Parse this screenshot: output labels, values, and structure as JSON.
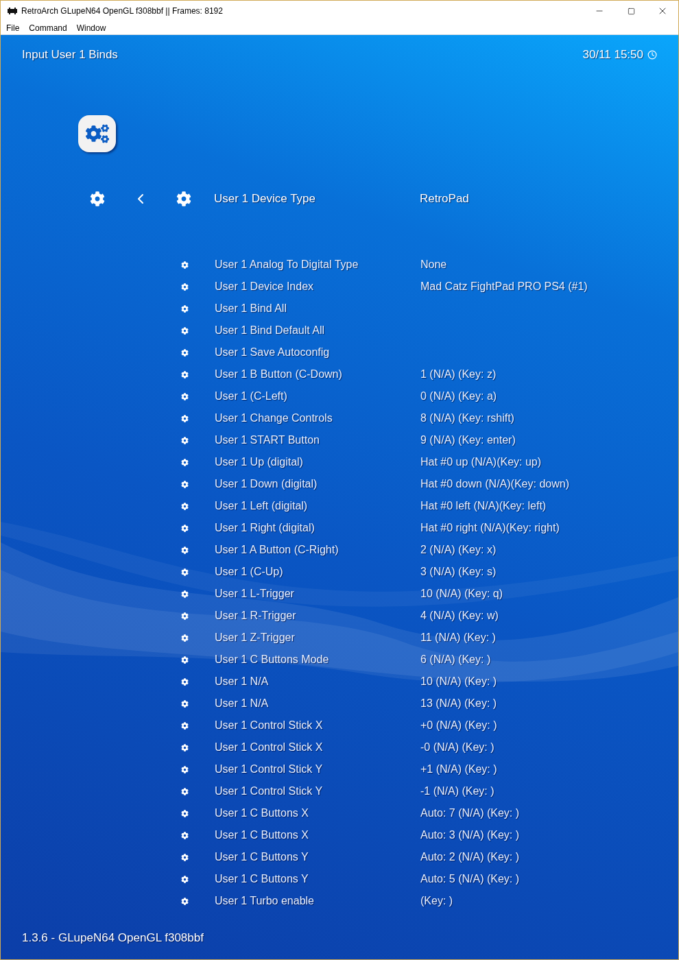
{
  "window": {
    "title": "RetroArch GLupeN64 OpenGL f308bbf || Frames: 8192"
  },
  "menu": [
    "File",
    "Command",
    "Window"
  ],
  "header": {
    "title": "Input User 1 Binds",
    "clock": "30/11 15:50"
  },
  "items": [
    {
      "label": "User 1 Device Type",
      "value": "RetroPad",
      "selected": true
    },
    {
      "label": "User 1 Analog To Digital Type",
      "value": "None",
      "selected": false
    },
    {
      "label": "User 1 Device Index",
      "value": "Mad Catz FightPad PRO PS4 (#1)",
      "selected": false
    },
    {
      "label": "User 1 Bind All",
      "selected": false
    },
    {
      "label": "User 1 Bind Default All",
      "selected": false
    },
    {
      "label": "User 1 Save Autoconfig",
      "selected": false
    },
    {
      "label": "User 1 B Button (C-Down)",
      "value": "1 (N/A) (Key: z)",
      "selected": false
    },
    {
      "label": "User 1 (C-Left)",
      "value": "0 (N/A) (Key: a)",
      "selected": false
    },
    {
      "label": "User 1 Change Controls",
      "value": "8 (N/A) (Key: rshift)",
      "selected": false
    },
    {
      "label": "User 1 START Button",
      "value": "9 (N/A) (Key: enter)",
      "selected": false
    },
    {
      "label": "User 1 Up (digital)",
      "value": "Hat #0 up (N/A)(Key: up)",
      "selected": false
    },
    {
      "label": "User 1 Down (digital)",
      "value": "Hat #0 down (N/A)(Key: down)",
      "selected": false
    },
    {
      "label": "User 1 Left (digital)",
      "value": "Hat #0 left (N/A)(Key: left)",
      "selected": false
    },
    {
      "label": "User 1 Right (digital)",
      "value": "Hat #0 right (N/A)(Key: right)",
      "selected": false
    },
    {
      "label": "User 1 A Button (C-Right)",
      "value": "2 (N/A) (Key: x)",
      "selected": false
    },
    {
      "label": "User 1 (C-Up)",
      "value": "3 (N/A) (Key: s)",
      "selected": false
    },
    {
      "label": "User 1 L-Trigger",
      "value": "10 (N/A) (Key: q)",
      "selected": false
    },
    {
      "label": "User 1 R-Trigger",
      "value": "4 (N/A) (Key: w)",
      "selected": false
    },
    {
      "label": "User 1 Z-Trigger",
      "value": "11 (N/A) (Key: )",
      "selected": false
    },
    {
      "label": "User 1 C Buttons Mode",
      "value": "6 (N/A) (Key: )",
      "selected": false
    },
    {
      "label": "User 1 N/A",
      "value": "10 (N/A) (Key: )",
      "selected": false
    },
    {
      "label": "User 1 N/A",
      "value": "13 (N/A) (Key: )",
      "selected": false
    },
    {
      "label": "User 1 Control Stick X",
      "value": "+0 (N/A) (Key: )",
      "selected": false
    },
    {
      "label": "User 1 Control Stick X",
      "value": "-0 (N/A) (Key: )",
      "selected": false
    },
    {
      "label": "User 1 Control Stick Y",
      "value": "+1 (N/A) (Key: )",
      "selected": false
    },
    {
      "label": "User 1 Control Stick Y",
      "value": "-1 (N/A) (Key: )",
      "selected": false
    },
    {
      "label": "User 1 C Buttons X",
      "value": "Auto: 7 (N/A) (Key: )",
      "selected": false
    },
    {
      "label": "User 1 C Buttons X",
      "value": "Auto: 3 (N/A) (Key: )",
      "selected": false
    },
    {
      "label": "User 1 C Buttons Y",
      "value": "Auto: 2 (N/A) (Key: )",
      "selected": false
    },
    {
      "label": "User 1 C Buttons Y",
      "value": "Auto: 5 (N/A) (Key: )",
      "selected": false
    },
    {
      "label": "User 1 Turbo enable",
      "value": "(Key: )",
      "selected": false
    }
  ],
  "footer": "1.3.6 - GLupeN64 OpenGL f308bbf"
}
